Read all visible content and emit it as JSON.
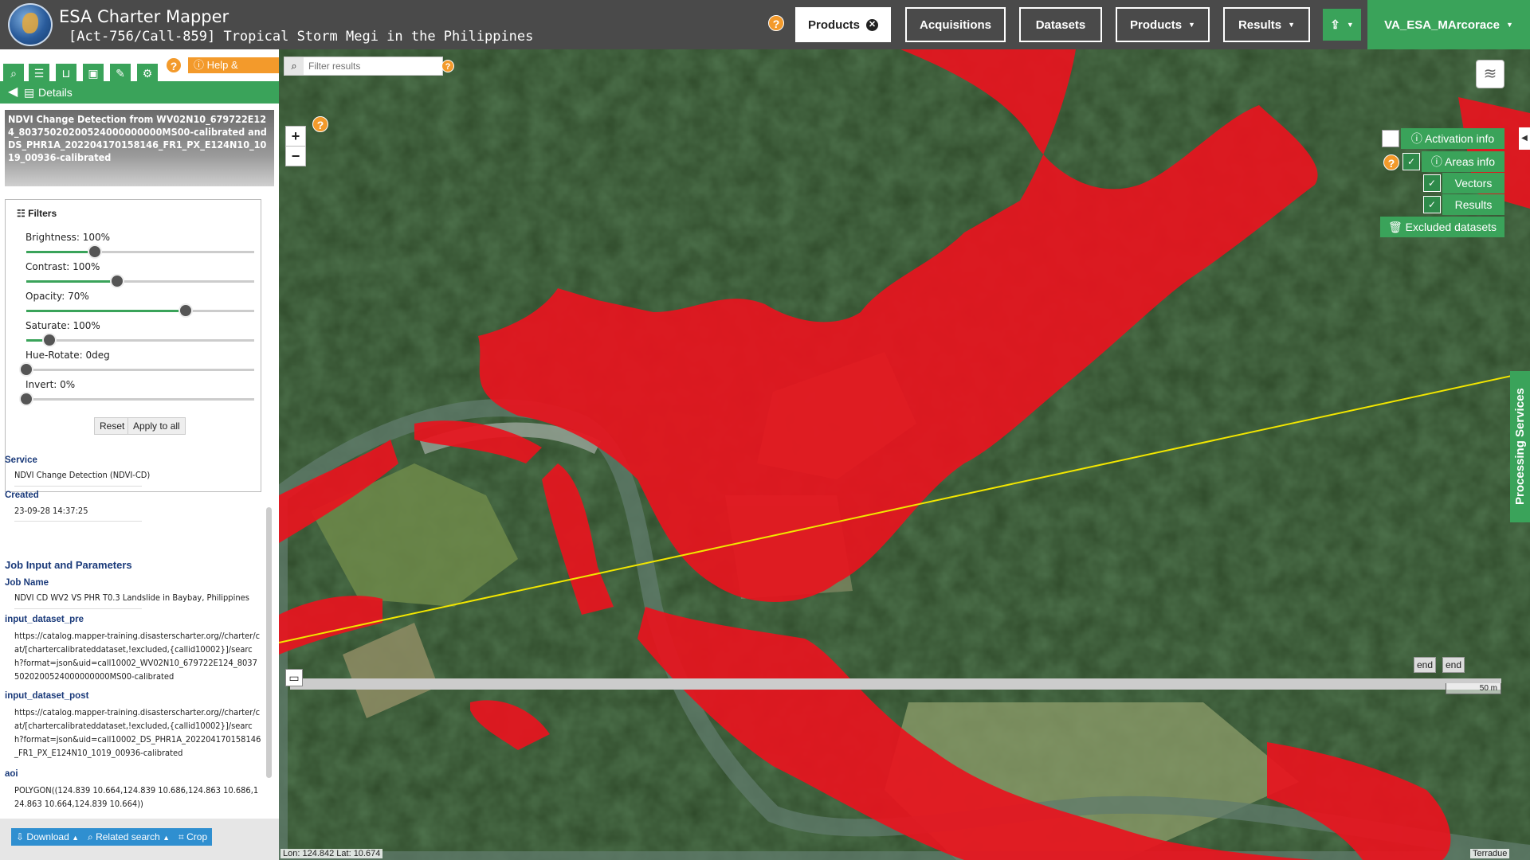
{
  "header": {
    "app_title": "ESA Charter Mapper",
    "activation_title": "[Act-756/Call-859] Tropical Storm Megi in the Philippines",
    "help_icon": "?",
    "tabs": {
      "products_active": "Products",
      "acquisitions": "Acquisitions",
      "datasets": "Datasets",
      "products_menu": "Products",
      "results": "Results"
    },
    "user": "VA_ESA_MArcorace"
  },
  "left_panel": {
    "help_manual": "Help & Manual",
    "details_label": "Details",
    "product_title": "NDVI Change Detection from WV02N10_679722E124_80375020200524000000000MS00-calibrated and DS_PHR1A_202204170158146_FR1_PX_E124N10_1019_00936-calibrated",
    "filters": {
      "title": "Filters",
      "items": [
        {
          "label": "Brightness: 100%",
          "level": 0.3
        },
        {
          "label": "Contrast: 100%",
          "level": 0.4
        },
        {
          "label": "Opacity: 70%",
          "level": 0.7
        },
        {
          "label": "Saturate: 100%",
          "level": 0.1
        },
        {
          "label": "Hue-Rotate: 0deg",
          "level": 0.0
        },
        {
          "label": "Invert: 0%",
          "level": 0.0
        }
      ],
      "reset": "Reset",
      "apply_all": "Apply to all"
    },
    "service_key": "Service",
    "service_val": "NDVI Change Detection (NDVI-CD)",
    "created_key": "Created",
    "created_val": "23-09-28 14:37:25",
    "job_section": "Job Input and Parameters",
    "job_name_key": "Job Name",
    "job_name_val": "NDVI CD WV2 VS PHR T0.3 Landslide in Baybay, Philippines",
    "input_pre_key": "input_dataset_pre",
    "input_pre_val": "https://catalog.mapper-training.disasterscharter.org//charter/cat/[chartercalibrateddataset,!excluded,{callid10002}]/search?format=json&uid=call10002_WV02N10_679722E124_80375020200524000000000MS00-calibrated",
    "input_post_key": "input_dataset_post",
    "input_post_val": "https://catalog.mapper-training.disasterscharter.org//charter/cat/[chartercalibrateddataset,!excluded,{callid10002}]/search?format=json&uid=call10002_DS_PHR1A_202204170158146_FR1_PX_E124N10_1019_00936-calibrated",
    "aoi_key": "aoi",
    "aoi_val": "POLYGON((124.839 10.664,124.839 10.686,124.863 10.686,124.863 10.664,124.839 10.664))",
    "bottom_buttons": {
      "download": "Download",
      "related": "Related search",
      "crop": "Crop"
    }
  },
  "map": {
    "search_placeholder": "Filter results",
    "zoom_in": "+",
    "zoom_out": "−",
    "activation_info": "Activation info",
    "areas_info": "Areas info",
    "vectors": "Vectors",
    "results": "Results",
    "excluded_datasets": "Excluded datasets",
    "processing_services": "Processing Services",
    "end_1": "end",
    "end_2": "end",
    "scale": "50 m",
    "coords": "Lon: 124.842 Lat: 10.674",
    "attribution": "Terradue"
  },
  "colors": {
    "accent_green": "#3aa35a",
    "header_gray": "#4a4a4a",
    "help_orange": "#f39a2b",
    "change_red": "#e8141e",
    "track_yellow": "#f2e600"
  },
  "icons": [
    "search-icon",
    "list-icon",
    "basket-icon",
    "archive-icon",
    "pencil-icon",
    "gear-icon",
    "layers-icon",
    "info-icon",
    "check-icon",
    "trash-icon",
    "upload-icon",
    "filters-icon",
    "download-icon"
  ]
}
